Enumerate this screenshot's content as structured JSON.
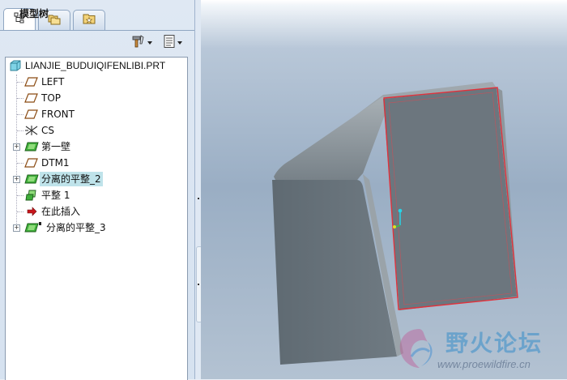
{
  "left_panel": {
    "tabs": [
      {
        "icon": "model-tree-icon",
        "active": true
      },
      {
        "icon": "folder-browser-icon",
        "active": false
      },
      {
        "icon": "favorites-icon",
        "active": false
      }
    ],
    "title": "模型树",
    "settings_button_icon": "hammer-settings-icon",
    "show_button_icon": "show-list-icon"
  },
  "tree": {
    "root": "LIANJIE_BUDUIQIFENLIBI.PRT",
    "items": [
      {
        "label": "LEFT",
        "icon": "datum-plane-icon",
        "expandable": false
      },
      {
        "label": "TOP",
        "icon": "datum-plane-icon",
        "expandable": false
      },
      {
        "label": "FRONT",
        "icon": "datum-plane-icon",
        "expandable": false
      },
      {
        "label": "CS",
        "icon": "coordinate-system-icon",
        "expandable": false
      },
      {
        "label": "第一壁",
        "icon": "sheetmetal-wall-icon",
        "expandable": true
      },
      {
        "label": "DTM1",
        "icon": "datum-plane-icon",
        "expandable": false
      },
      {
        "label": "分离的平整_2",
        "icon": "sheetmetal-wall-icon",
        "expandable": true,
        "selected": true
      },
      {
        "label": "平整 1",
        "icon": "flat-wall-icon",
        "expandable": false
      },
      {
        "label": "在此插入",
        "icon": "insert-here-arrow-icon",
        "expandable": false
      },
      {
        "label": "分离的平整_3",
        "icon": "sheetmetal-wall-icon",
        "expandable": true
      }
    ]
  },
  "watermark": {
    "title": "野火论坛",
    "url": "www.proewildfire.cn"
  },
  "colors": {
    "highlight": "#bfe3ea",
    "selection_edge": "#e0323c",
    "part_gray": "#6f7a82"
  }
}
